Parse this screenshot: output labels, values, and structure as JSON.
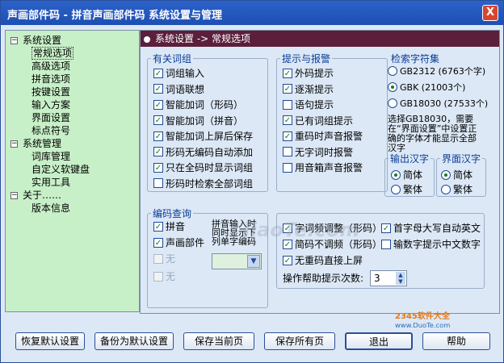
{
  "window": {
    "title": "声画部件码 - 拼音声画部件码  系统设置与管理",
    "close_label": "X"
  },
  "tree": [
    {
      "label": "系统设置",
      "level": 0,
      "exp": "−"
    },
    {
      "label": "常规选项",
      "level": 1,
      "selected": true
    },
    {
      "label": "高级选项",
      "level": 1
    },
    {
      "label": "拼音选项",
      "level": 1
    },
    {
      "label": "按键设置",
      "level": 1
    },
    {
      "label": "输入方案",
      "level": 1
    },
    {
      "label": "界面设置",
      "level": 1
    },
    {
      "label": "标点符号",
      "level": 1
    },
    {
      "label": "系统管理",
      "level": 0,
      "exp": "−"
    },
    {
      "label": "词库管理",
      "level": 1
    },
    {
      "label": "自定义软键盘",
      "level": 1
    },
    {
      "label": "实用工具",
      "level": 1
    },
    {
      "label": "关于……",
      "level": 0,
      "exp": "−"
    },
    {
      "label": "版本信息",
      "level": 1
    }
  ],
  "panel_header": "系统设置 -> 常规选项",
  "groups": {
    "phrase": {
      "title": "有关词组",
      "items": [
        {
          "label": "词组输入",
          "checked": true
        },
        {
          "label": "词语联想",
          "checked": true
        },
        {
          "label": "智能加词（形码）",
          "checked": true
        },
        {
          "label": "智能加词（拼音）",
          "checked": true
        },
        {
          "label": "智能加词上屏后保存",
          "checked": true
        },
        {
          "label": "形码无编码自动添加",
          "checked": true
        },
        {
          "label": "只在全码时显示词组",
          "checked": true
        },
        {
          "label": "形码时检索全部词组",
          "checked": false
        }
      ]
    },
    "alert": {
      "title": "提示与报警",
      "items": [
        {
          "label": "外码提示",
          "checked": true
        },
        {
          "label": "逐渐提示",
          "checked": true
        },
        {
          "label": "语句提示",
          "checked": false
        },
        {
          "label": "已有词组提示",
          "checked": true
        },
        {
          "label": "重码时声音报警",
          "checked": true
        },
        {
          "label": "无字词时报警",
          "checked": false
        },
        {
          "label": "用音箱声音报警",
          "checked": false
        }
      ]
    },
    "charset": {
      "title": "检索字符集",
      "options": [
        {
          "label": "GB2312 (6763个字)",
          "on": false
        },
        {
          "label": "GBK  (21003个)",
          "on": true
        },
        {
          "label": "GB18030 (27533个)",
          "on": false
        }
      ],
      "note": "选择GB18030，需要在“界面设置”中设置正确的字体才能显示全部汉字"
    },
    "output": {
      "title": "输出汉字",
      "simplified": "简体",
      "traditional": "繁体",
      "selected": "简体"
    },
    "ui_lang": {
      "title": "界面汉字",
      "simplified": "简体",
      "traditional": "繁体",
      "selected": "简体"
    },
    "code_query": {
      "title": "编码查询",
      "pinyin_label": "拼音",
      "shengh_label": "声画部件",
      "none1_label": "无",
      "none2_label": "无",
      "note": "拼音输入时同时显示下列单字编码"
    },
    "misc": {
      "items": [
        {
          "label": "字词频调整（形码）",
          "checked": true
        },
        {
          "label": "首字母大写自动英文",
          "checked": true
        },
        {
          "label": "简码不调频（形码）",
          "checked": true
        },
        {
          "label": "输数字提示中文数字",
          "checked": false
        },
        {
          "label": "无重码直接上屏",
          "checked": true
        }
      ],
      "help_label": "操作帮助提示次数:",
      "help_value": "3"
    }
  },
  "buttons": {
    "restore": "恢复默认设置",
    "backup": "备份为默认设置",
    "save_page": "保存当前页",
    "save_all": "保存所有页",
    "exit": "退出",
    "help": "帮助"
  },
  "watermark": "JiaoTe.com",
  "logo": {
    "brand": "2345软件大全",
    "url": "www.DuoTe.com"
  }
}
